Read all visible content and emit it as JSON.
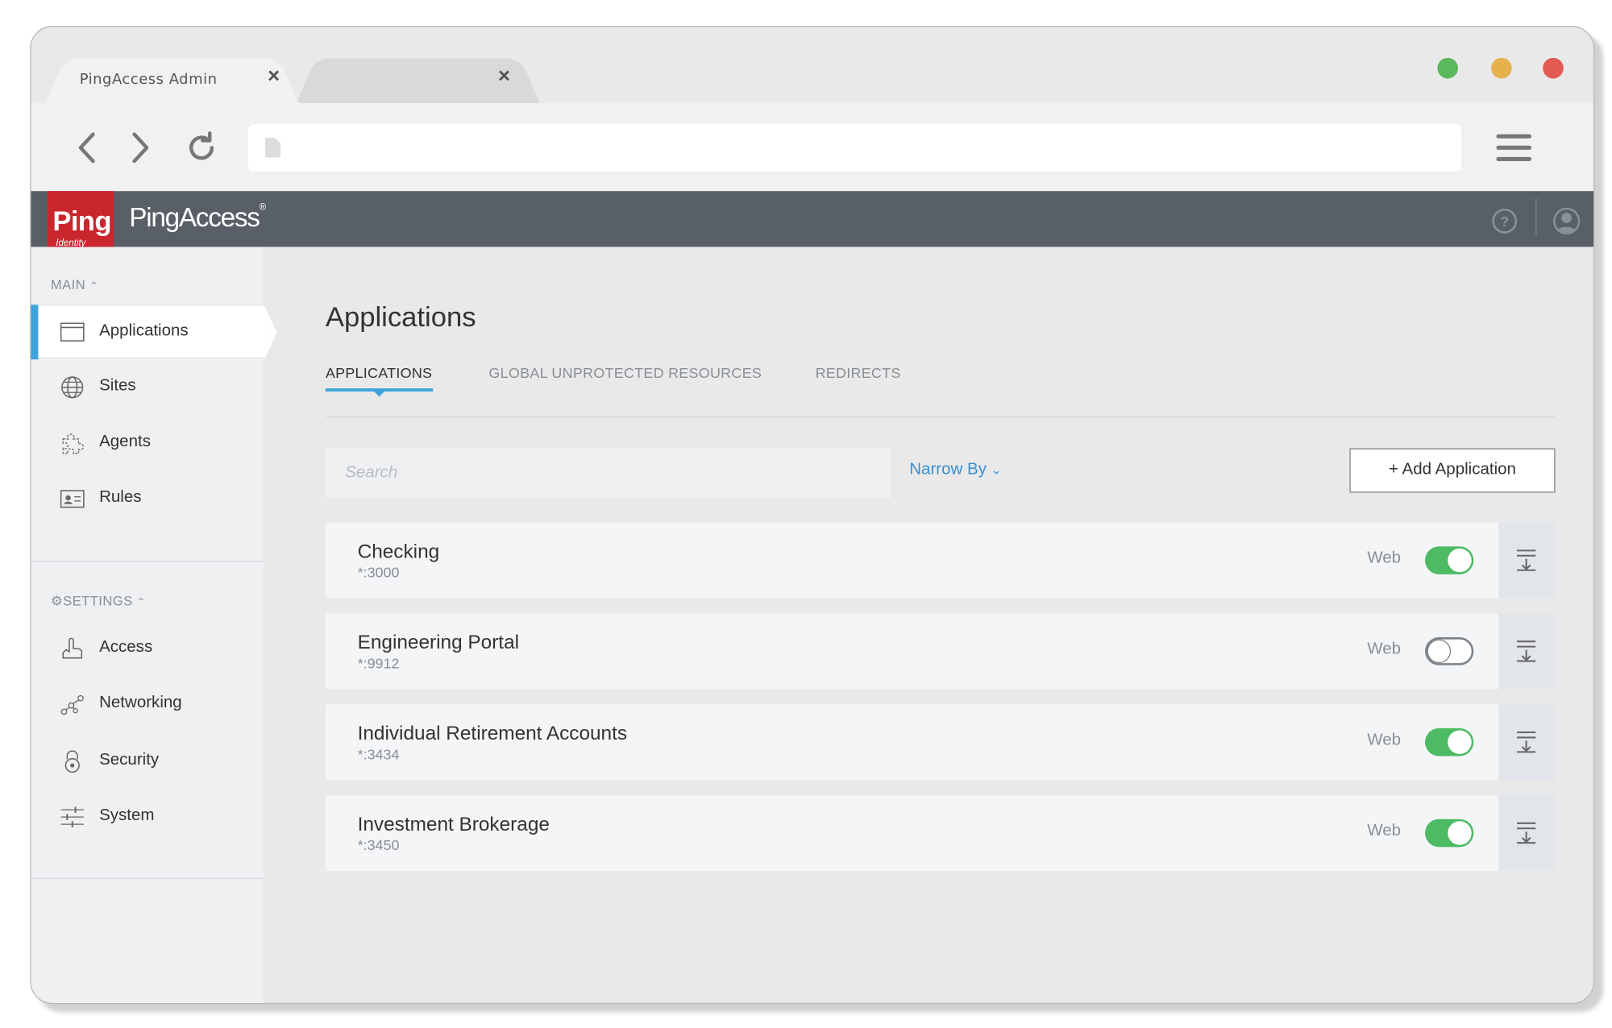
{
  "browser": {
    "tabs": [
      {
        "title": "PingAccess Admin",
        "close": "×"
      },
      {
        "title": "",
        "close": "×"
      }
    ],
    "url": ""
  },
  "header": {
    "logo_word": "Ping",
    "logo_sub": "Identity",
    "brand": "PingAccess",
    "brand_mark": "®",
    "help_symbol": "?"
  },
  "sidebar": {
    "main_heading": "MAIN",
    "settings_heading": "SETTINGS",
    "main_items": [
      {
        "label": "Applications",
        "icon": "application-window-icon",
        "active": true
      },
      {
        "label": "Sites",
        "icon": "globe-icon",
        "active": false
      },
      {
        "label": "Agents",
        "icon": "puzzle-icon",
        "active": false
      },
      {
        "label": "Rules",
        "icon": "id-card-icon",
        "active": false
      }
    ],
    "settings_items": [
      {
        "label": "Access",
        "icon": "hand-icon"
      },
      {
        "label": "Networking",
        "icon": "network-icon"
      },
      {
        "label": "Security",
        "icon": "lock-icon"
      },
      {
        "label": "System",
        "icon": "sliders-icon"
      }
    ]
  },
  "main": {
    "title": "Applications",
    "tabs": [
      "APPLICATIONS",
      "GLOBAL UNPROTECTED RESOURCES",
      "REDIRECTS"
    ],
    "search_placeholder": "Search",
    "narrow_by": "Narrow By",
    "add_button": "+ Add Application",
    "applications": [
      {
        "name": "Checking",
        "port": "*:3000",
        "type": "Web",
        "enabled": true
      },
      {
        "name": "Engineering Portal",
        "port": "*:9912",
        "type": "Web",
        "enabled": false
      },
      {
        "name": "Individual Retirement Accounts",
        "port": "*:3434",
        "type": "Web",
        "enabled": true
      },
      {
        "name": "Investment Brokerage",
        "port": "*:3450",
        "type": "Web",
        "enabled": true
      }
    ]
  },
  "colors": {
    "accent": "#3ea3dc",
    "toggle_on": "#4dbb63",
    "brand_red": "#c9262d",
    "header_bg": "#585f66"
  }
}
